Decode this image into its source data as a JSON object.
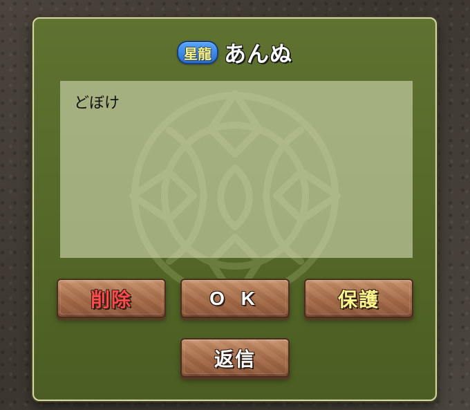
{
  "dialog": {
    "rank_badge": "星龍",
    "player_name": "あんぬ",
    "message": "どぼけ"
  },
  "buttons": {
    "delete": "削除",
    "ok": "O K",
    "protect": "保護",
    "reply": "返信"
  },
  "colors": {
    "dialog_bg": "#5a6d2d",
    "message_panel": "#d7ddb7",
    "button_brown": "#a46a47",
    "delete_text": "#ff4a4a",
    "protect_text": "#fff58c",
    "badge_blue": "#3f86e0"
  },
  "icons": {
    "background_emblem": "ornate-crest"
  }
}
